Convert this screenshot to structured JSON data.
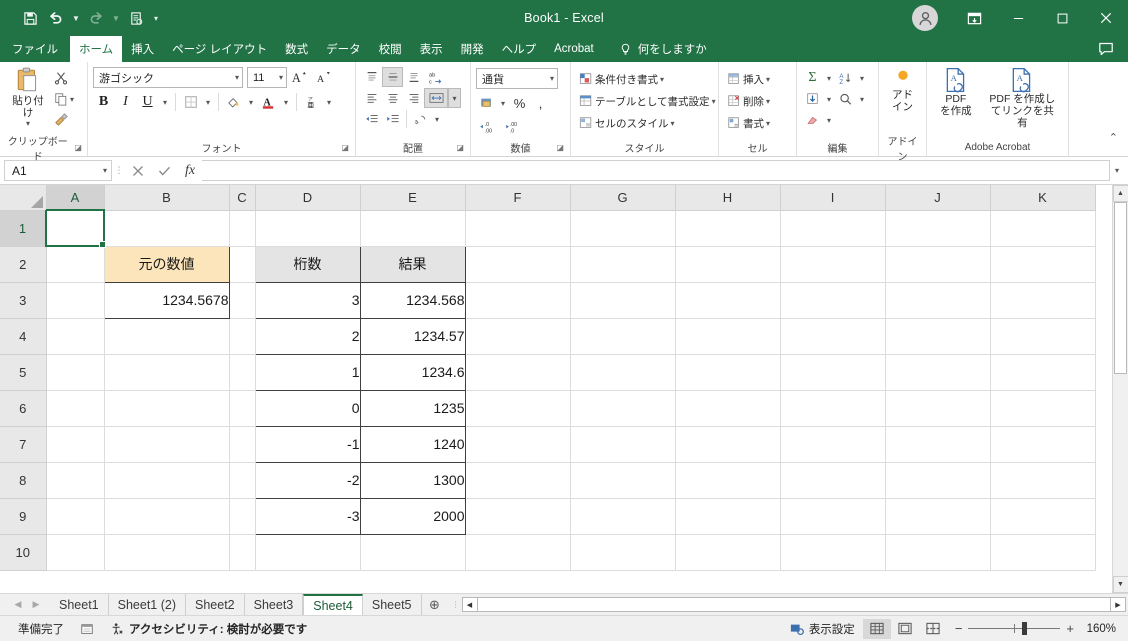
{
  "window": {
    "title": "Book1 - Excel",
    "minimize_label": "最小化",
    "maximize_label": "最大化",
    "close_label": "閉じる",
    "ribbon_display_label": "リボンの表示オプション",
    "account_label": "アカウント",
    "comment_label": "コメント"
  },
  "quick_access": {
    "save": "上書き保存",
    "undo": "元に戻す",
    "redo": "やり直し",
    "print_preview": "印刷プレビューと印刷",
    "customize": "クイック アクセス ツール バーのユーザー設定"
  },
  "tabs": [
    {
      "label": "ファイル",
      "active": false
    },
    {
      "label": "ホーム",
      "active": true
    },
    {
      "label": "挿入",
      "active": false
    },
    {
      "label": "ページ レイアウト",
      "active": false
    },
    {
      "label": "数式",
      "active": false
    },
    {
      "label": "データ",
      "active": false
    },
    {
      "label": "校閲",
      "active": false
    },
    {
      "label": "表示",
      "active": false
    },
    {
      "label": "開発",
      "active": false
    },
    {
      "label": "ヘルプ",
      "active": false
    },
    {
      "label": "Acrobat",
      "active": false
    }
  ],
  "tellme": {
    "label": "何をしますか"
  },
  "ribbon": {
    "clipboard": {
      "group_label": "クリップボード",
      "paste_label": "貼り付け",
      "cut_label": "切り取り",
      "copy_label": "コピー",
      "format_painter_label": "書式のコピー/貼り付け"
    },
    "font": {
      "group_label": "フォント",
      "font_name": "游ゴシック",
      "font_size": "11",
      "grow_font": "フォント サイズの拡大",
      "shrink_font": "フォント サイズの縮小",
      "bold": "B",
      "italic": "I",
      "underline": "U",
      "borders_label": "罫線",
      "fill_color_label": "塗りつぶしの色",
      "font_color_label": "フォントの色",
      "phonetic_label": "ふりがなの表示/非表示"
    },
    "alignment": {
      "group_label": "配置",
      "align_top": "上揃え",
      "align_middle": "上下中央揃え",
      "align_bottom": "下揃え",
      "wrap_text": "折り返して全体を表示する",
      "align_left": "左揃え",
      "align_center": "中央揃え",
      "align_right": "右揃え",
      "merge_center": "セルを結合して中央揃え",
      "decrease_indent": "インデントを減らす",
      "increase_indent": "インデントを増やす",
      "orientation": "方向"
    },
    "number": {
      "group_label": "数値",
      "format_value": "通貨",
      "accounting_label": "通貨表示形式",
      "percent_label": "パーセント スタイル",
      "comma_label": "桁区切りスタイル",
      "increase_decimal_label": "小数点以下の表示桁数を増やす",
      "decrease_decimal_label": "小数点以下の表示桁数を減らす"
    },
    "styles": {
      "group_label": "スタイル",
      "conditional_formatting": "条件付き書式",
      "format_as_table": "テーブルとして書式設定",
      "cell_styles": "セルのスタイル"
    },
    "cells": {
      "group_label": "セル",
      "insert": "挿入",
      "delete": "削除",
      "format": "書式"
    },
    "editing": {
      "group_label": "編集",
      "autosum": "合計",
      "fill": "フィル",
      "clear": "クリア",
      "sort_filter": "並べ替えとフィルター",
      "find_select": "検索と選択"
    },
    "addins": {
      "group_label": "アドイン",
      "button_label": "アド\nイン",
      "button_line1": "アド",
      "button_line2": "イン"
    },
    "acrobat": {
      "group_label": "Adobe Acrobat",
      "create_pdf_line1": "PDF",
      "create_pdf_line2": "を作成",
      "share_pdf_line1": "PDF を作成し",
      "share_pdf_line2": "てリンクを共有"
    },
    "collapse_label": "リボンを折りたたむ"
  },
  "formula_bar": {
    "name_box_value": "A1",
    "cancel_label": "キャンセル",
    "enter_label": "入力",
    "fx_label": "関数の挿入",
    "formula_value": "",
    "expand_label": "数式バーの展開"
  },
  "grid": {
    "columns": [
      "A",
      "B",
      "C",
      "D",
      "E",
      "F",
      "G",
      "H",
      "I",
      "J",
      "K"
    ],
    "active_column": "A",
    "active_row": "1",
    "selected_cell": "A1",
    "rows": [
      {
        "n": "1",
        "B": "",
        "D": "",
        "E": ""
      },
      {
        "n": "2",
        "B": "元の数値",
        "D": "桁数",
        "E": "結果"
      },
      {
        "n": "3",
        "B": "1234.5678",
        "D": "3",
        "E": "1234.568"
      },
      {
        "n": "4",
        "B": "",
        "D": "2",
        "E": "1234.57"
      },
      {
        "n": "5",
        "B": "",
        "D": "1",
        "E": "1234.6"
      },
      {
        "n": "6",
        "B": "",
        "D": "0",
        "E": "1235"
      },
      {
        "n": "7",
        "B": "",
        "D": "-1",
        "E": "1240"
      },
      {
        "n": "8",
        "B": "",
        "D": "-2",
        "E": "1300"
      },
      {
        "n": "9",
        "B": "",
        "D": "-3",
        "E": "2000"
      },
      {
        "n": "10",
        "B": "",
        "D": "",
        "E": ""
      }
    ],
    "colors": {
      "header_tan": "#fce5ba",
      "header_gray": "#e4e4e4",
      "selection": "#217346"
    }
  },
  "sheet_tabs": {
    "first_label": "先頭シート",
    "prev_label": "前のシート",
    "next_label": "次のシート",
    "last_label": "最終シート",
    "add_label": "新しいシート",
    "items": [
      {
        "label": "Sheet1",
        "active": false
      },
      {
        "label": "Sheet1 (2)",
        "active": false
      },
      {
        "label": "Sheet2",
        "active": false
      },
      {
        "label": "Sheet3",
        "active": false
      },
      {
        "label": "Sheet4",
        "active": true
      },
      {
        "label": "Sheet5",
        "active": false
      }
    ]
  },
  "status_bar": {
    "mode": "準備完了",
    "macro_label": "マクロの記録",
    "accessibility": "アクセシビリティ: 検討が必要です",
    "display_settings": "表示設定",
    "view_normal": "標準",
    "view_pagelayout": "ページ レイアウト",
    "view_pagebreak": "改ページ プレビュー",
    "zoom_out": "−",
    "zoom_in": "+",
    "zoom_value": "160%"
  }
}
